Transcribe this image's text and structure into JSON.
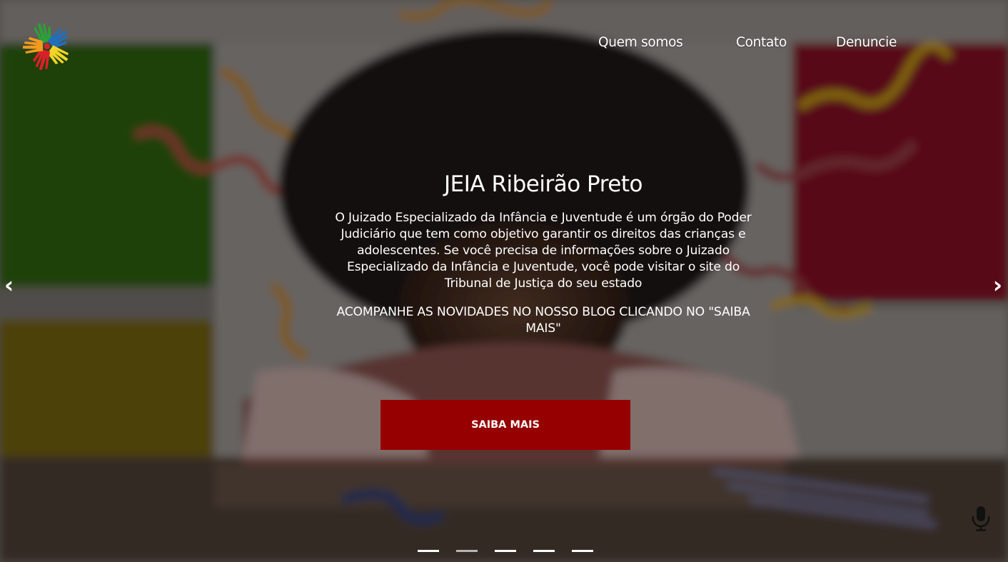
{
  "nav": {
    "items": [
      "Quem somos",
      "Contato",
      "Denuncie"
    ]
  },
  "hero": {
    "title": "JEIA Ribeirão Preto",
    "description": "O Juizado Especializado da Infância e Juventude é um órgão do Poder Judiciário que tem como objetivo garantir os direitos das crianças e adolescentes. Se você precisa de informações sobre o Juizado Especializado da Infância e Juventude, você pode visitar o site do Tribunal de Justiça do seu estado",
    "cta_text": "ACOMPANHE AS NOVIDADES NO NOSSO BLOG CLICANDO NO \"SAIBA MAIS\"",
    "button_label": "SAIBA MAIS",
    "prev_label": "‹",
    "next_label": "›"
  },
  "carousel": {
    "slide_count": 5,
    "active_index": 1
  },
  "icons": {
    "logo": "colorful-hands-logo-icon",
    "mic": "microphone-icon"
  },
  "colors": {
    "button": "#960000",
    "hand_green": "#2e9e3a",
    "hand_blue": "#1f6fbf",
    "hand_orange": "#f39a1f",
    "hand_red": "#d8222a",
    "hand_yellow": "#f2d526"
  }
}
